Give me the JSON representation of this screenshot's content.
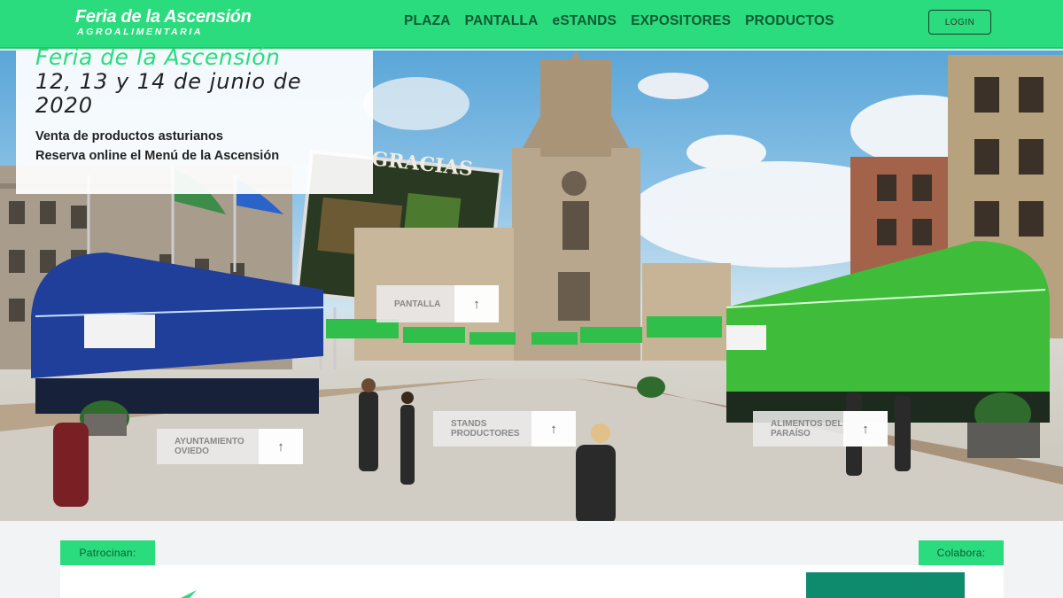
{
  "header": {
    "logo_title": "Feria de la Ascensión",
    "logo_subtitle": "AGROALIMENTARIA",
    "nav": [
      "PLAZA",
      "PANTALLA",
      "eSTANDS",
      "EXPOSITORES",
      "PRODUCTOS"
    ],
    "login_label": "LOGIN"
  },
  "info": {
    "title": "Feria de la Ascensión",
    "date": "12, 13 y 14 de junio de 2020",
    "line1": "Venta de productos asturianos",
    "line2": "Reserva online el Menú de la Ascensión"
  },
  "billboard": {
    "text": "GRACIAS"
  },
  "hotspots": {
    "pantalla": "PANTALLA",
    "ayuntamiento": "AYUNTAMIENTO OVIEDO",
    "stands": "STANDS PRODUCTORES",
    "alimentos": "ALIMENTOS DEL PARAÍSO"
  },
  "footer": {
    "patrocinan": "Patrocinan:",
    "colabora": "Colabora:"
  },
  "colors": {
    "brand_green": "#2bdc7e",
    "dark_green": "#0f5a33",
    "stand_blue": "#1f3f9a",
    "stand_green": "#3fbd3a"
  }
}
